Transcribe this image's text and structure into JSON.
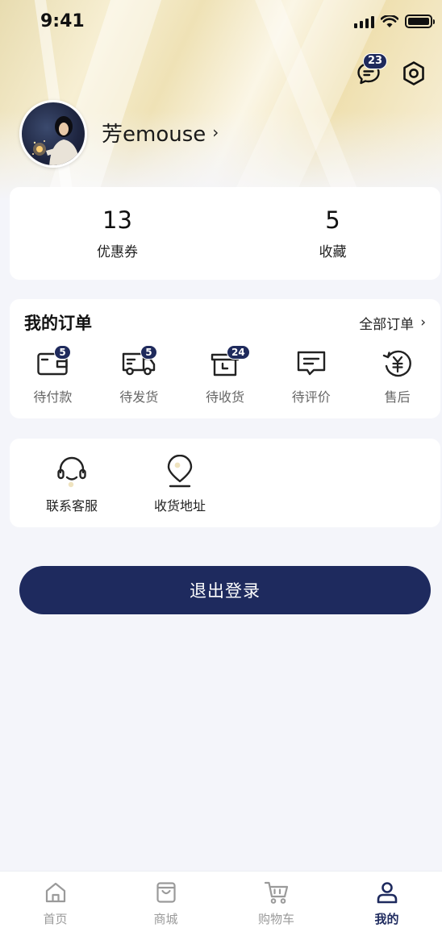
{
  "status_bar": {
    "time": "9:41"
  },
  "header": {
    "message_badge": "23",
    "username": "芳emouse",
    "username_chevron": "›"
  },
  "stats": [
    {
      "value": "13",
      "label": "优惠券"
    },
    {
      "value": "5",
      "label": "收藏"
    }
  ],
  "orders": {
    "title": "我的订单",
    "all_label": "全部订单",
    "all_chevron": "›",
    "items": [
      {
        "label": "待付款",
        "badge": "5",
        "icon": "wallet-icon"
      },
      {
        "label": "待发货",
        "badge": "5",
        "icon": "truck-icon"
      },
      {
        "label": "待收货",
        "badge": "24",
        "icon": "box-icon"
      },
      {
        "label": "待评价",
        "badge": "",
        "icon": "comment-icon"
      },
      {
        "label": "售后",
        "badge": "",
        "icon": "after-sales-icon"
      }
    ]
  },
  "services": [
    {
      "label": "联系客服",
      "icon": "headset-icon"
    },
    {
      "label": "收货地址",
      "icon": "location-pin-icon"
    }
  ],
  "logout_label": "退出登录",
  "tabbar": [
    {
      "label": "首页",
      "icon": "home-icon",
      "active": false
    },
    {
      "label": "商城",
      "icon": "shopping-bag-icon",
      "active": false
    },
    {
      "label": "购物车",
      "icon": "cart-icon",
      "active": false
    },
    {
      "label": "我的",
      "icon": "user-icon",
      "active": true
    }
  ],
  "colors": {
    "accent": "#1e2a5e",
    "badge": "#1f2a5c",
    "background": "#f4f5fa"
  }
}
